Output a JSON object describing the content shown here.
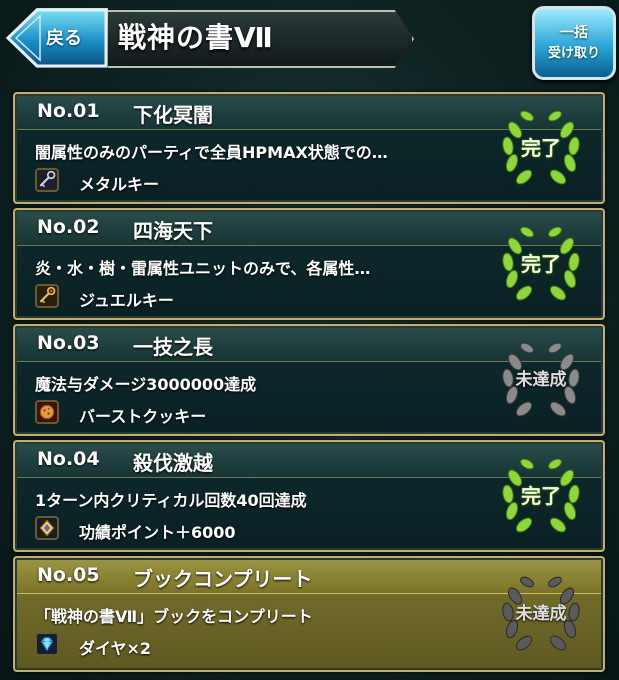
{
  "header": {
    "back_label": "戻る",
    "title": "戦神の書Ⅶ",
    "bulk_line1": "一括",
    "bulk_line2": "受け取り"
  },
  "colors": {
    "complete_wreath": "#7ecb2a",
    "incomplete_wreath": "#7f7f7f",
    "highlight_card": "#7b7430",
    "back_button": "#1a8fc6"
  },
  "missions": [
    {
      "no": "No.01",
      "name": "下化冥闇",
      "desc": "闇属性のみのパーティで全員HPMAX状態での…",
      "reward": "メタルキー",
      "reward_icon": "metal-key-icon",
      "status": "完了",
      "completed": true
    },
    {
      "no": "No.02",
      "name": "四海天下",
      "desc": "炎・水・樹・雷属性ユニットのみで、各属性…",
      "reward": "ジュエルキー",
      "reward_icon": "jewel-key-icon",
      "status": "完了",
      "completed": true
    },
    {
      "no": "No.03",
      "name": "一技之長",
      "desc": "魔法与ダメージ3000000達成",
      "reward": "バーストクッキー",
      "reward_icon": "burst-cookie-icon",
      "status": "未達成",
      "completed": false
    },
    {
      "no": "No.04",
      "name": "殺伐激越",
      "desc": "1ターン内クリティカル回数40回達成",
      "reward": "功績ポイント＋6000",
      "reward_icon": "merit-point-icon",
      "status": "完了",
      "completed": true
    },
    {
      "no": "No.05",
      "name": "ブックコンプリート",
      "desc": "「戦神の書Ⅶ」ブックをコンプリート",
      "reward": "ダイヤ×2",
      "reward_icon": "diamond-icon",
      "status": "未達成",
      "completed": false
    }
  ]
}
